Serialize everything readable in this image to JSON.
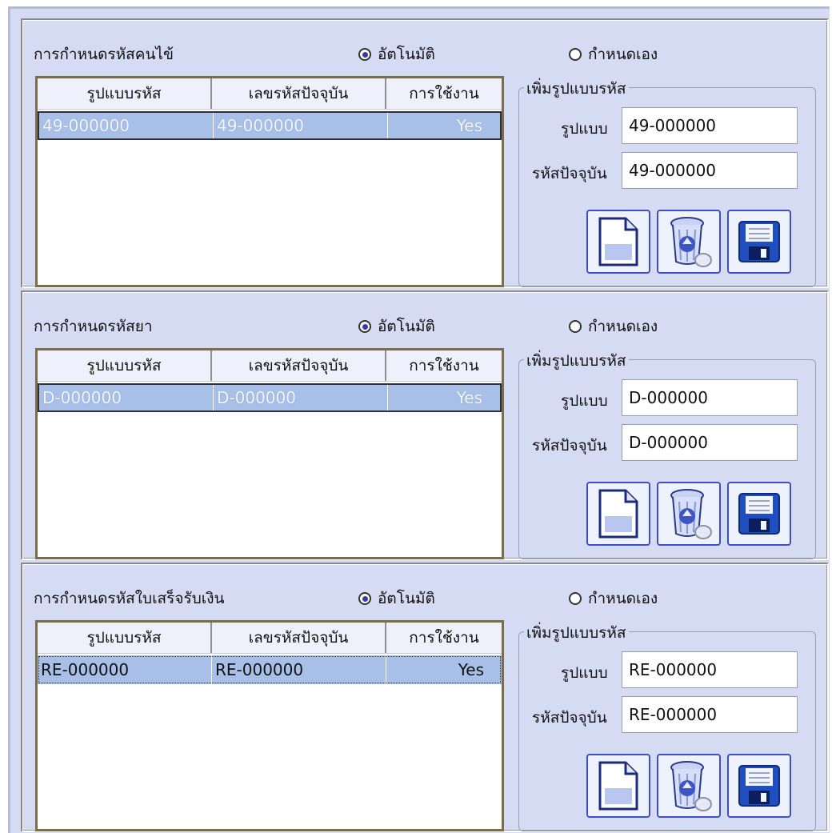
{
  "panels": [
    {
      "title": "การกำหนดรหัสคนไข้",
      "radio_auto": "อัตโนมัติ",
      "radio_manual": "กำหนดเอง",
      "auto_selected": true,
      "columns": [
        "รูปแบบรหัส",
        "เลขรหัสปัจจุบัน",
        "การใช้งาน"
      ],
      "rows": [
        [
          "49-000000",
          "49-000000",
          "Yes"
        ]
      ],
      "group_title": "เพิ่มรูปแบบรหัส",
      "format_label": "รูปแบบ",
      "format_value": "49-000000",
      "current_label": "รหัสปัจจุบัน",
      "current_value": "49-000000"
    },
    {
      "title": "การกำหนดรหัสยา",
      "radio_auto": "อัตโนมัติ",
      "radio_manual": "กำหนดเอง",
      "auto_selected": true,
      "columns": [
        "รูปแบบรหัส",
        "เลขรหัสปัจจุบัน",
        "การใช้งาน"
      ],
      "rows": [
        [
          "D-000000",
          "D-000000",
          "Yes"
        ]
      ],
      "group_title": "เพิ่มรูปแบบรหัส",
      "format_label": "รูปแบบ",
      "format_value": "D-000000",
      "current_label": "รหัสปัจจุบัน",
      "current_value": "D-000000"
    },
    {
      "title": "การกำหนดรหัสใบเสร็จรับเงิน",
      "radio_auto": "อัตโนมัติ",
      "radio_manual": "กำหนดเอง",
      "auto_selected": true,
      "columns": [
        "รูปแบบรหัส",
        "เลขรหัสปัจจุบัน",
        "การใช้งาน"
      ],
      "rows": [
        [
          "RE-000000",
          "RE-000000",
          "Yes"
        ]
      ],
      "group_title": "เพิ่มรูปแบบรหัส",
      "format_label": "รูปแบบ",
      "format_value": "RE-000000",
      "current_label": "รหัสปัจจุบัน",
      "current_value": "RE-000000"
    }
  ],
  "icons": {
    "new": "new-document-icon",
    "delete": "recycle-bin-icon",
    "save": "floppy-disk-icon"
  },
  "colors": {
    "background": "#d4dbf3",
    "selected_row": "#a8bfe8",
    "button_border": "#3c4fc8",
    "grid_border": "#7a6d48"
  }
}
